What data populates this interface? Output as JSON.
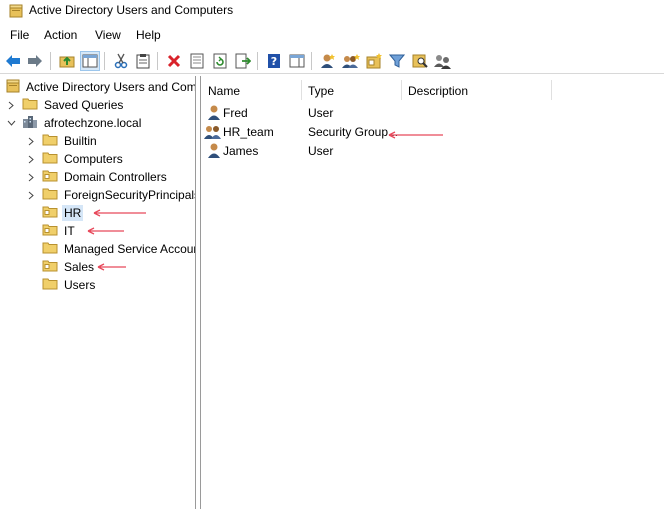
{
  "window": {
    "title": "Active Directory Users and Computers"
  },
  "menu": {
    "file": "File",
    "action": "Action",
    "view": "View",
    "help": "Help"
  },
  "toolbar": {
    "icons": [
      "back-icon",
      "forward-icon",
      "up-folder-icon",
      "show-hide-tree-icon",
      "cut-icon",
      "paste-icon",
      "delete-icon",
      "properties-icon",
      "refresh-icon",
      "export-icon",
      "help-icon",
      "action-pane-icon",
      "new-user-icon",
      "new-group-icon",
      "new-ou-icon",
      "filter-icon",
      "find-icon",
      "delegate-icon"
    ]
  },
  "tree": {
    "root": "Active Directory Users and Computers",
    "saved_queries": "Saved Queries",
    "domain": "afrotechzone.local",
    "children": [
      "Builtin",
      "Computers",
      "Domain Controllers",
      "ForeignSecurityPrincipals",
      "HR",
      "IT",
      "Managed Service Accounts",
      "Sales",
      "Users"
    ]
  },
  "list": {
    "columns": {
      "name": "Name",
      "type": "Type",
      "description": "Description"
    },
    "rows": [
      {
        "name": "Fred",
        "type": "User",
        "description": "",
        "icon": "user-icon"
      },
      {
        "name": "HR_team",
        "type": "Security Group...",
        "description": "",
        "icon": "group-icon"
      },
      {
        "name": "James",
        "type": "User",
        "description": "",
        "icon": "user-icon"
      }
    ]
  },
  "colors": {
    "annotation": "#e8495b",
    "selection": "#d5e6f7",
    "folder": "#e8c15a"
  }
}
